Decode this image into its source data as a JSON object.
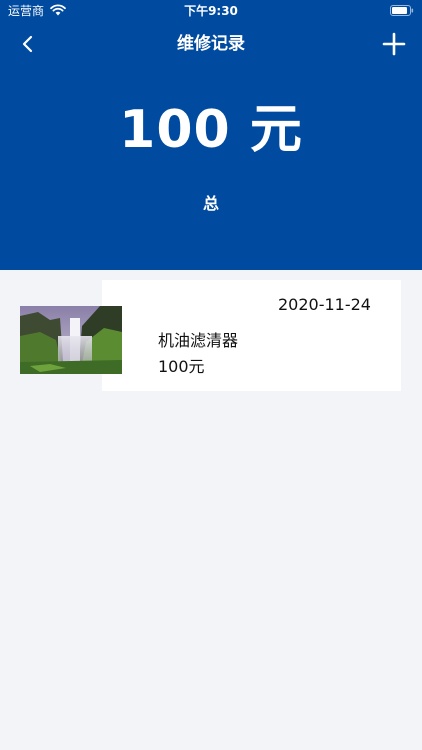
{
  "status_bar": {
    "carrier": "运营商",
    "time": "下午9:30"
  },
  "nav": {
    "title": "维修记录"
  },
  "summary": {
    "total": "100 元",
    "label": "总"
  },
  "records": [
    {
      "date": "2020-11-24",
      "name": "机油滤清器",
      "cost": "100元",
      "thumbnail": "waterfall-photo"
    }
  ],
  "colors": {
    "header_bg": "#004ba0",
    "page_bg": "#f3f4f8",
    "card_bg": "#ffffff"
  },
  "icons": [
    "wifi-icon",
    "battery-icon",
    "back-chevron-icon",
    "plus-icon"
  ]
}
